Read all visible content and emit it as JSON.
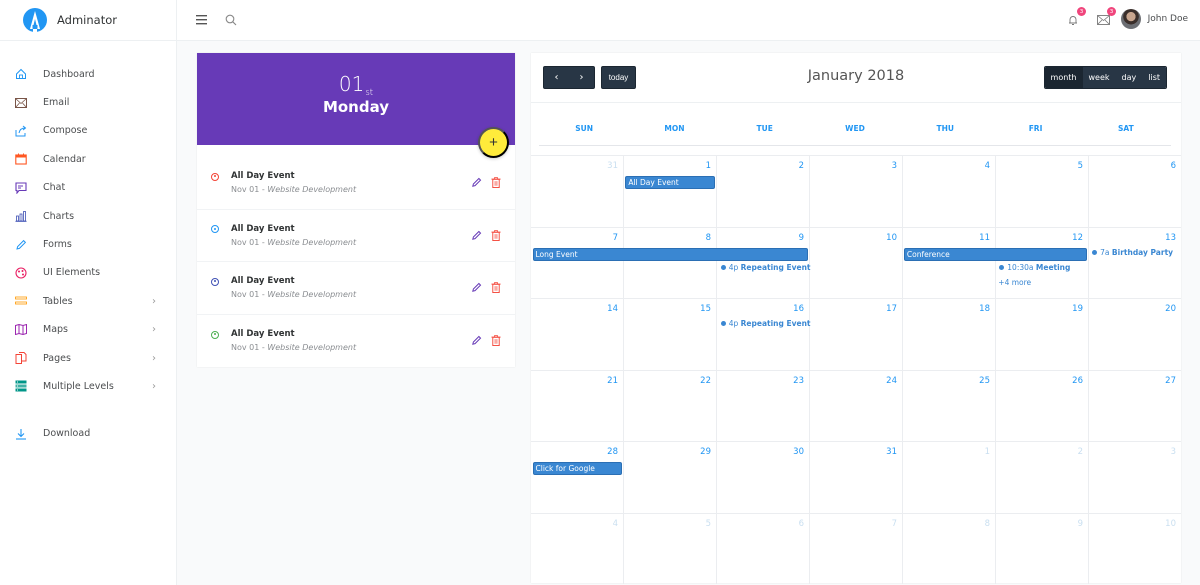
{
  "app": {
    "name": "Adminator",
    "brand_color": "#2196f3"
  },
  "sidebar": {
    "items": [
      {
        "label": "Dashboard",
        "icon": "home-icon",
        "color": "#2196f3",
        "chevron": false
      },
      {
        "label": "Email",
        "icon": "email-icon",
        "color": "#795548",
        "chevron": false
      },
      {
        "label": "Compose",
        "icon": "share-icon",
        "color": "#2196f3",
        "chevron": false
      },
      {
        "label": "Calendar",
        "icon": "calendar-icon",
        "color": "#ff5722",
        "chevron": false
      },
      {
        "label": "Chat",
        "icon": "chat-icon",
        "color": "#673ab7",
        "chevron": false
      },
      {
        "label": "Charts",
        "icon": "bar-chart-icon",
        "color": "#3f51b5",
        "chevron": false
      },
      {
        "label": "Forms",
        "icon": "pencil-icon",
        "color": "#2196f3",
        "chevron": false
      },
      {
        "label": "UI Elements",
        "icon": "palette-icon",
        "color": "#e91e63",
        "chevron": false
      },
      {
        "label": "Tables",
        "icon": "list-icon",
        "color": "#ff9800",
        "chevron": true
      },
      {
        "label": "Maps",
        "icon": "map-icon",
        "color": "#9c27b0",
        "chevron": true
      },
      {
        "label": "Pages",
        "icon": "files-icon",
        "color": "#f44336",
        "chevron": true
      },
      {
        "label": "Multiple Levels",
        "icon": "layers-icon",
        "color": "#009688",
        "chevron": true
      }
    ],
    "download": {
      "label": "Download",
      "icon": "download-icon",
      "color": "#2196f3"
    }
  },
  "topbar": {
    "notifications_count": "3",
    "messages_count": "3",
    "user_name": "John Doe"
  },
  "day_panel": {
    "day_number": "01",
    "day_suffix": "st",
    "weekday": "Monday",
    "add_label": "+",
    "header_color": "#673ab7",
    "events": [
      {
        "title": "All Day Event",
        "date": "Nov 01",
        "separator": " - ",
        "desc": "Website Development",
        "color": "#f44336"
      },
      {
        "title": "All Day Event",
        "date": "Nov 01",
        "separator": " - ",
        "desc": "Website Development",
        "color": "#2196f3"
      },
      {
        "title": "All Day Event",
        "date": "Nov 01",
        "separator": " - ",
        "desc": "Website Development",
        "color": "#3f51b5"
      },
      {
        "title": "All Day Event",
        "date": "Nov 01",
        "separator": " - ",
        "desc": "Website Development",
        "color": "#4caf50"
      }
    ]
  },
  "calendar": {
    "title": "January 2018",
    "prev_label": "‹",
    "next_label": "›",
    "today_label": "today",
    "views": [
      "month",
      "week",
      "day",
      "list"
    ],
    "active_view": "month",
    "weekdays": [
      "SUN",
      "MON",
      "TUE",
      "WED",
      "THU",
      "FRI",
      "SAT"
    ],
    "weeks": [
      [
        {
          "n": "31",
          "o": true
        },
        {
          "n": "1"
        },
        {
          "n": "2"
        },
        {
          "n": "3"
        },
        {
          "n": "4"
        },
        {
          "n": "5"
        },
        {
          "n": "6"
        }
      ],
      [
        {
          "n": "7"
        },
        {
          "n": "8"
        },
        {
          "n": "9"
        },
        {
          "n": "10"
        },
        {
          "n": "11"
        },
        {
          "n": "12"
        },
        {
          "n": "13"
        }
      ],
      [
        {
          "n": "14"
        },
        {
          "n": "15"
        },
        {
          "n": "16"
        },
        {
          "n": "17"
        },
        {
          "n": "18"
        },
        {
          "n": "19"
        },
        {
          "n": "20"
        }
      ],
      [
        {
          "n": "21"
        },
        {
          "n": "22"
        },
        {
          "n": "23"
        },
        {
          "n": "24"
        },
        {
          "n": "25"
        },
        {
          "n": "26"
        },
        {
          "n": "27"
        }
      ],
      [
        {
          "n": "28"
        },
        {
          "n": "29"
        },
        {
          "n": "30"
        },
        {
          "n": "31"
        },
        {
          "n": "1",
          "o": true
        },
        {
          "n": "2",
          "o": true
        },
        {
          "n": "3",
          "o": true
        }
      ],
      [
        {
          "n": "4",
          "o": true
        },
        {
          "n": "5",
          "o": true
        },
        {
          "n": "6",
          "o": true
        },
        {
          "n": "7",
          "o": true
        },
        {
          "n": "8",
          "o": true
        },
        {
          "n": "9",
          "o": true
        },
        {
          "n": "10",
          "o": true
        }
      ]
    ],
    "bar_events": [
      {
        "title": "All Day Event",
        "week": 0,
        "start": 1,
        "span": 1
      },
      {
        "title": "Long Event",
        "week": 1,
        "start": 0,
        "span": 3
      },
      {
        "title": "Conference",
        "week": 1,
        "start": 4,
        "span": 2
      },
      {
        "title": "Click for Google",
        "week": 4,
        "start": 0,
        "span": 1
      }
    ],
    "dot_events": [
      {
        "time": "4p",
        "title": "Repeating Event",
        "week": 1,
        "day": 2,
        "row": 1
      },
      {
        "time": "10:30a",
        "title": "Meeting",
        "week": 1,
        "day": 5,
        "row": 1
      },
      {
        "time": "7a",
        "title": "Birthday Party",
        "week": 1,
        "day": 6,
        "row": 0
      },
      {
        "time": "4p",
        "title": "Repeating Event",
        "week": 2,
        "day": 2,
        "row": 0
      }
    ],
    "more_links": [
      {
        "label": "+4 more",
        "week": 1,
        "day": 5
      }
    ],
    "event_color": "#3a87d2"
  }
}
